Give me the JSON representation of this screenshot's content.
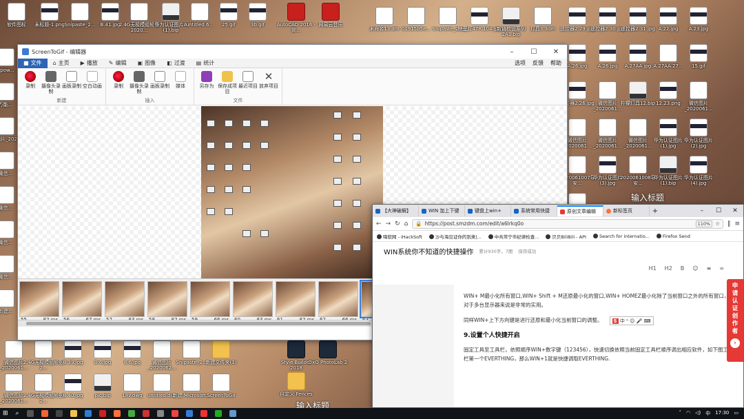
{
  "desktop": {
    "top_icons": [
      "软件图标",
      "未标题-1.png",
      "Snipaste_2...",
      "B.41.jpg",
      "2.4G无极模组轮毂2020...",
      "华为认证图片A (1).bip",
      "untitled.6...",
      "25.gif",
      "3b.gif",
      "AutoCAD 2016 - 简...",
      "网易云音乐"
    ],
    "mid_icons": [
      "未命名13.dm",
      "01915b5e...",
      "Snipaste_2...",
      "映歪灯4TR.104.jpg",
      "新链检设系列2A1.bip",
      "灯具3.3dm"
    ],
    "right_icons": [
      "遥控器2.29.jpg",
      "遥控器2.30.jpg",
      "遥控器2.31.jpg",
      "A.22.jpg",
      "A.23.jpg",
      "A.26.jpg",
      "A.26.jpg",
      "A.27AA.jpg",
      "A.27AA.27...",
      "15.gif",
      "遥控器2.26.jpg",
      "微信图片_2020061...",
      "柠檬灯具12.bip",
      "12.23.png",
      "微信图片_2020061...",
      "微信图片_2020061...",
      "微信图片_2020061...",
      "微信图片_2020061...",
      "华为认证图片(1).jpg",
      "华为认证图片(2).jpg",
      "2020061007导安...",
      "华为认证图片(3).jpg",
      "2020061008导安...",
      "华为认证图片(1).bip",
      "华为认证图片(4).jpg",
      "华为认证图片(1).3dm"
    ],
    "left_icons": [
      "Apow...",
      "万能...",
      "微信图片_2020...",
      "微信...",
      "微信...",
      "微信...",
      "微信...",
      "新建..."
    ],
    "bottom_icons": [
      "微信图片_2020061...",
      "2.4G无极模组轮毂2...",
      "B.39.jpg",
      "B.6.jpg",
      "8.6.jpg",
      "微信图片_2020062...",
      "Snipaste_2...",
      "新建文件夹(3)",
      "微信图片_2020061...",
      "2.4G无极模组轮毂2...",
      "B.40.jpg",
      "pic.bip",
      "18v.dwg",
      "untitled.di...",
      "新建 Microsoft...",
      "ScreenToGif"
    ],
    "bottom_right_icons": [
      "Style Builder 2018",
      "DxO PhotoLab 2",
      "自定义 Fences"
    ],
    "banners": [
      "输入标题",
      "输入标题"
    ],
    "watermark": "值 什么值得买"
  },
  "app": {
    "title": "ScreenToGif - 编辑器",
    "tabs": [
      "文件",
      "主页",
      "播放",
      "编辑",
      "图像",
      "过渡",
      "统计"
    ],
    "right_menu": [
      "选项",
      "反馈",
      "帮助"
    ],
    "groups": [
      {
        "name": "新建",
        "buttons": [
          "录制",
          "摄像头录制",
          "画板录制",
          "空白动画"
        ]
      },
      {
        "name": "插入",
        "buttons": [
          "录制",
          "摄像头录制",
          "画板录制",
          "媒体"
        ]
      },
      {
        "name": "文件",
        "buttons": [
          "另存为",
          "保存成项目",
          "最近项目",
          "放弃项目"
        ]
      }
    ],
    "frames": [
      {
        "n": "55",
        "ms": "82 ms"
      },
      {
        "n": "56",
        "ms": "67 ms"
      },
      {
        "n": "57",
        "ms": "83 ms"
      },
      {
        "n": "58",
        "ms": "82 ms"
      },
      {
        "n": "59",
        "ms": "66 ms"
      },
      {
        "n": "60",
        "ms": "83 ms"
      },
      {
        "n": "61",
        "ms": "82 ms"
      },
      {
        "n": "62",
        "ms": "66 ms"
      },
      {
        "n": "63",
        "ms": ""
      }
    ]
  },
  "browser": {
    "tabs": [
      "【大神破解】",
      "WIN 加上下键",
      "键盘上win+",
      "系统常用快捷",
      "原创文章编辑",
      "新标签页"
    ],
    "url": "https://post.smzdm.com/edit/a6lrkq0o",
    "zoom": "110%",
    "bookmarks": [
      "嗨软网 - iHackSoft",
      "沙与海见证你的到来|...",
      "中共常宁市纪律检查...",
      "贝贝BiliBili - API",
      "Search for internatio...",
      "Firefox Send"
    ],
    "article_title": "WIN系统你不知道的快捷操作",
    "article_meta": "累计930字，7图",
    "save_state": "保存成功",
    "edit_tools": [
      "H1",
      "H2",
      "B",
      "☺",
      "≡",
      "∞"
    ],
    "para1": "WIN+ M最小化所有窗口,WIN+ Shift + M还原最小化的窗口,WIN+ HOMEZ最小化除了当前窗口之外的所有窗口，对于多台显示器来说是非常的实用。",
    "para2": "同样WIN+上下方向键是进行还原和最小化当前窗口的调整。",
    "heading": "9.设置个人快捷开启",
    "para3": "固定工具至工具栏，依照顺序WIN+数字键（123456），快速切换依照当前固定工具栏顺序调出相应软件，如下图工具栏第一个EVERTHING，那么WIN+1就是快捷调取EVERTHING.",
    "side_apply": "申请认证创作者",
    "toolbar_glyph": "中 ⁰ ☺ 🎤 ⌨"
  },
  "taskbar": {
    "time": "17:30",
    "ime": "中"
  }
}
